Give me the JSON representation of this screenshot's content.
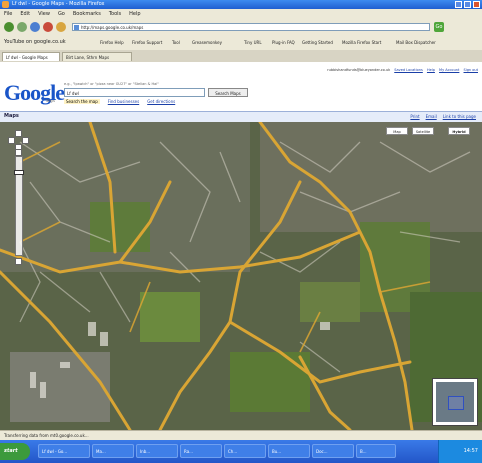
{
  "window": {
    "title": "Lf dwl - Google Maps - Mozilla Firefox"
  },
  "menu": [
    "File",
    "Edit",
    "View",
    "Go",
    "Bookmarks",
    "Tools",
    "Help"
  ],
  "address": {
    "url": "http://maps.google.co.uk/maps",
    "go_label": "Go"
  },
  "toolbar": {
    "search_label": "YouTube on google.co.uk",
    "bookmarks": [
      "Firefox Help",
      "Firefox Support",
      "Tool",
      "Greasemonkey",
      "Tiny URL",
      "Plug-in FAQ",
      "Getting Started",
      "Mozilla Firefox Start",
      "Mail Box Dispatcher"
    ]
  },
  "tabs": [
    "Lf dwl - Google Maps",
    "Birt Lane, Sthrn Maps"
  ],
  "page": {
    "logo": "Google",
    "logo_sub": "Maps",
    "search_hint": "e.g., \"Ipswich\" or \"pizza near GU27\" or \"Stelian & Hai\"",
    "search_value": "Lf dwl",
    "search_button": "Search Maps",
    "search_tabs": [
      "Search the map",
      "Find businesses",
      "Get directions"
    ],
    "user_email": "rubbishandfunds@blueyonder.co.uk",
    "user_links": [
      "Saved Locations",
      "Help",
      "My Account",
      "Sign out"
    ],
    "section_label": "Maps",
    "map_links": [
      "Print",
      "Email",
      "Link to this page"
    ],
    "map_types": [
      "Map",
      "Satellite",
      "Hybrid"
    ],
    "selected_map_type": "Hybrid"
  },
  "status": {
    "text": "Transferring data from mt0.google.co.uk..."
  },
  "taskbar": {
    "start_label": "start",
    "tasks": [
      "Lf dwl - Go...",
      "Ma...",
      "Inb...",
      "Ra...",
      "Ch...",
      "Bu...",
      "Doc...",
      "B..."
    ],
    "clock": "14:57"
  }
}
